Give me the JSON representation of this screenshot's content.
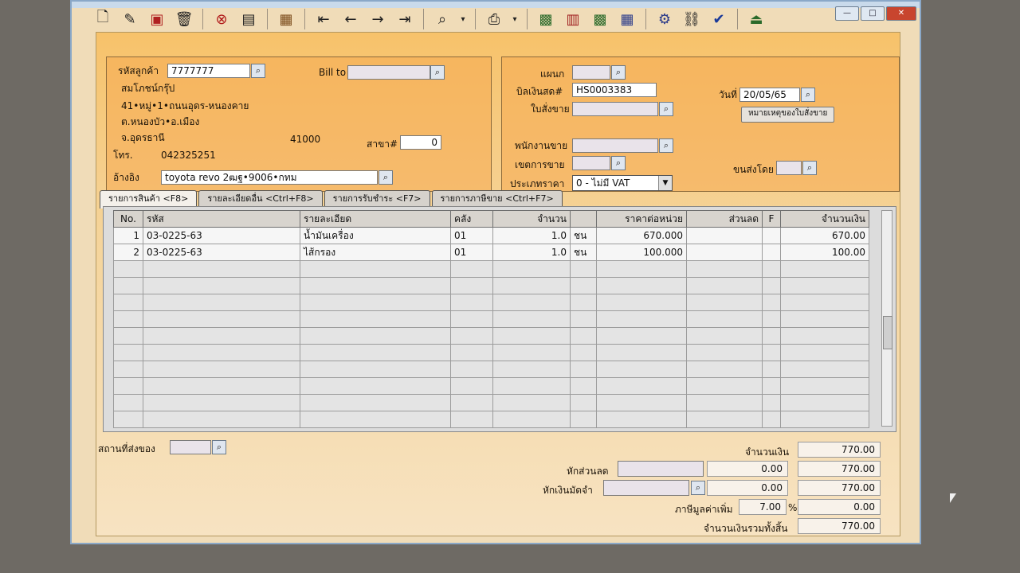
{
  "window": {
    "minimize": "—",
    "maximize": "□",
    "close": "✕"
  },
  "toolbar": [
    "new-icon",
    "edit-icon",
    "delete-icon",
    "trash-icon",
    "cancel-icon",
    "save-icon",
    "print-preview-icon",
    "first-icon",
    "prev-icon",
    "next-icon",
    "last-icon",
    "search-doc-icon",
    "printer-icon",
    "report1-icon",
    "report2-icon",
    "report3-icon",
    "report4-icon",
    "tools-icon",
    "link-icon",
    "ok-icon",
    "exit-icon"
  ],
  "customer": {
    "code_label": "รหัสลูกค้า",
    "code": "7777777",
    "name": "สมโภชน์กรุ๊ป",
    "addr1": "41•หมู่•1•ถนนอุดร-หนองคาย",
    "addr2": "ต.หนองบัว•อ.เมือง",
    "addr3": "จ.อุดรธานี",
    "zip": "41000",
    "branch_label": "สาขา#",
    "branch": "0",
    "tel_label": "โทร.",
    "tel": "042325251",
    "ref_label": "อ้างอิง",
    "ref": "toyota revo 2ฒฐ•9006•กทม",
    "billto_label": "Bill to"
  },
  "doc": {
    "dept_label": "แผนก",
    "invoice_label": "บิลเงินสด#",
    "invoice": "HS0003383",
    "so_label": "ใบสั่งขาย",
    "date_label": "วันที่",
    "date": "20/05/65",
    "note_btn": "หมายเหตุของใบสั่งขาย",
    "salesman_label": "พนักงานขาย",
    "area_label": "เขตการขาย",
    "pricetype_label": "ประเภทราคา",
    "pricetype": "0 - ไม่มี VAT",
    "ship_label": "ขนส่งโดย"
  },
  "tabs": [
    "รายการสินค้า <F8>",
    "รายละเอียดอื่น <Ctrl+F8>",
    "รายการรับชำระ <F7>",
    "รายการภาษีขาย <Ctrl+F7>"
  ],
  "grid": {
    "headers": [
      "No.",
      "รหัส",
      "รายละเอียด",
      "คลัง",
      "จำนวน",
      "",
      "ราคาต่อหน่วย",
      "ส่วนลด",
      "F",
      "จำนวนเงิน"
    ],
    "rows": [
      {
        "no": "1",
        "code": "03-0225-63",
        "desc": "น้ำมันเครื่อง",
        "wh": "01",
        "qty": "1.0",
        "unit": "ชน",
        "price": "670.000",
        "disc": "",
        "f": "",
        "amount": "670.00"
      },
      {
        "no": "2",
        "code": "03-0225-63",
        "desc": "ไส้กรอง",
        "wh": "01",
        "qty": "1.0",
        "unit": "ชน",
        "price": "100.000",
        "disc": "",
        "f": "",
        "amount": "100.00"
      }
    ]
  },
  "footer": {
    "ship_place_label": "สถานที่ส่งของ",
    "amount_label": "จำนวนเงิน",
    "amount": "770.00",
    "discount_label": "หักส่วนลด",
    "discount": "0.00",
    "after_discount": "770.00",
    "deposit_label": "หักเงินมัดจำ",
    "deposit": "0.00",
    "after_deposit": "770.00",
    "vat_label": "ภาษีมูลค่าเพิ่ม",
    "vat_rate": "7.00",
    "vat_pct": "%",
    "vat_amount": "0.00",
    "total_label": "จำนวนเงินรวมทั้งสิ้น",
    "total": "770.00"
  }
}
